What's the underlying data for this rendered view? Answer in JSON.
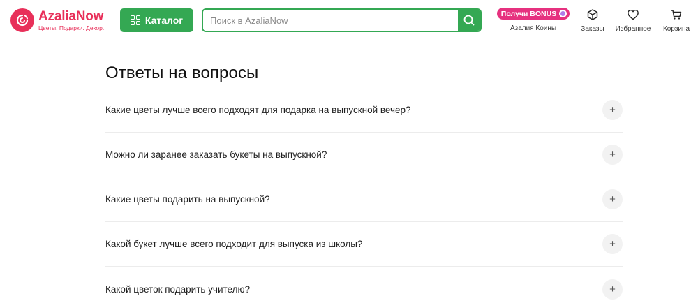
{
  "brand": {
    "name": "AzaliaNow",
    "tagline": "Цветы. Подарки. Декор.",
    "color": "#e8305a"
  },
  "header": {
    "catalog_label": "Каталог",
    "search_placeholder": "Поиск в AzaliaNow",
    "bonus_label": "Получи BONUS",
    "bonus_caption": "Азалия Коины",
    "nav": [
      {
        "icon": "box-icon",
        "label": "Заказы"
      },
      {
        "icon": "heart-icon",
        "label": "Избранное"
      },
      {
        "icon": "cart-icon",
        "label": "Корзина"
      }
    ]
  },
  "faq": {
    "title": "Ответы на вопросы",
    "items": [
      {
        "question": "Какие цветы лучше всего подходят для подарка на выпускной вечер?",
        "toggle": "+"
      },
      {
        "question": "Можно ли заранее заказать букеты на выпускной?",
        "toggle": "+"
      },
      {
        "question": "Какие цветы подарить на выпускной?",
        "toggle": "+"
      },
      {
        "question": "Какой букет лучше всего подходит для выпуска из школы?",
        "toggle": "+"
      },
      {
        "question": "Какой цветок подарить учителю?",
        "toggle": "+"
      }
    ]
  },
  "colors": {
    "accent_green": "#34a853",
    "bonus_pink": "#e6317f",
    "coin_purple": "#b07be8"
  }
}
